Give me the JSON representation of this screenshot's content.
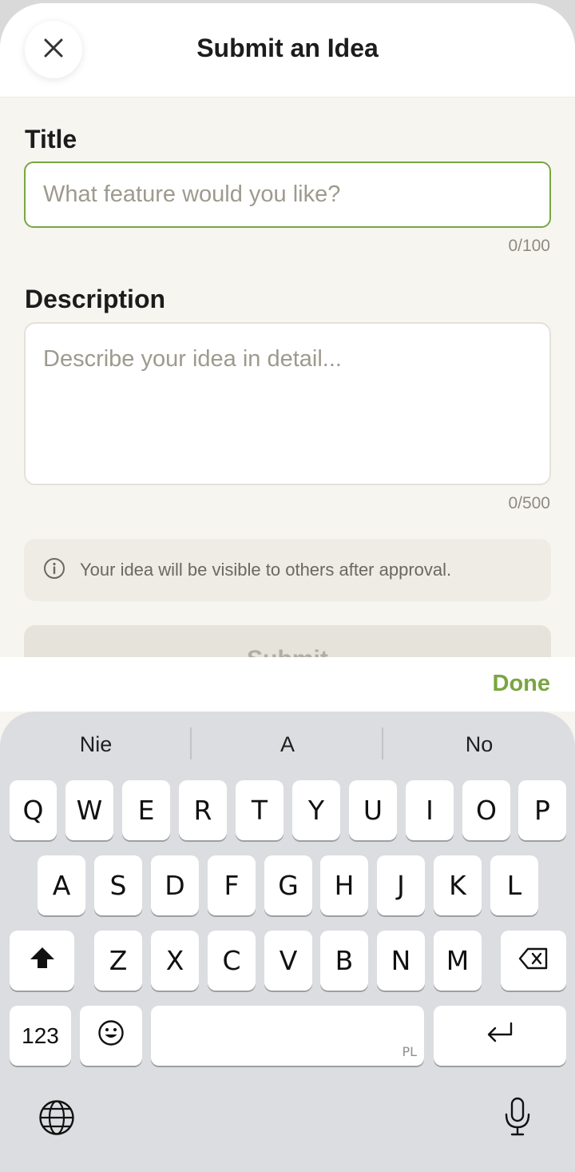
{
  "header": {
    "title": "Submit an Idea",
    "close_icon": "close-icon"
  },
  "form": {
    "title_label": "Title",
    "title_placeholder": "What feature would you like?",
    "title_value": "",
    "title_counter": "0/100",
    "description_label": "Description",
    "description_placeholder": "Describe your idea in detail...",
    "description_value": "",
    "description_counter": "0/500",
    "info_icon": "info-icon",
    "info_text": "Your idea will be visible to others after approval.",
    "submit_label": "Submit"
  },
  "accessory": {
    "done_label": "Done"
  },
  "keyboard": {
    "suggestions": [
      "Nie",
      "A",
      "No"
    ],
    "row1": [
      "Q",
      "W",
      "E",
      "R",
      "T",
      "Y",
      "U",
      "I",
      "O",
      "P"
    ],
    "row2": [
      "A",
      "S",
      "D",
      "F",
      "G",
      "H",
      "J",
      "K",
      "L"
    ],
    "row3": [
      "Z",
      "X",
      "C",
      "V",
      "B",
      "N",
      "M"
    ],
    "numbers_label": "123",
    "space_language": "PL",
    "icons": {
      "shift": "shift-icon",
      "backspace": "backspace-icon",
      "emoji": "emoji-icon",
      "return": "return-icon",
      "globe": "globe-icon",
      "mic": "microphone-icon"
    }
  },
  "colors": {
    "accent": "#7aa542",
    "background": "#f6f5f0",
    "keyboard": "#dcdde0"
  }
}
